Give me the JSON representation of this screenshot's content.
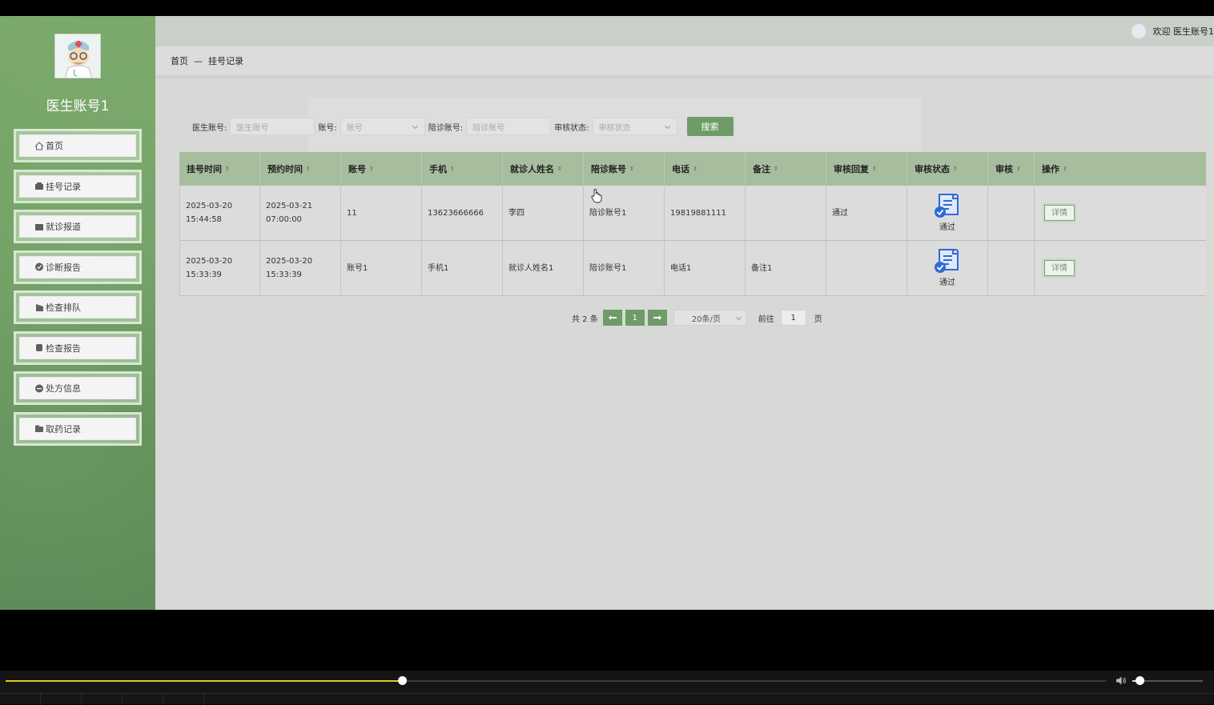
{
  "sidebar": {
    "user_name": "医生账号1",
    "menu": [
      {
        "label": "首页",
        "icon": "home-icon"
      },
      {
        "label": "挂号记录",
        "icon": "register-icon"
      },
      {
        "label": "就诊报道",
        "icon": "checkin-icon"
      },
      {
        "label": "诊断报告",
        "icon": "diagnosis-icon"
      },
      {
        "label": "检查排队",
        "icon": "queue-icon"
      },
      {
        "label": "检查报告",
        "icon": "report-icon"
      },
      {
        "label": "处方信息",
        "icon": "prescription-icon"
      },
      {
        "label": "取药记录",
        "icon": "medicine-icon"
      }
    ]
  },
  "header": {
    "welcome": "欢迎 医生账号1"
  },
  "breadcrumb": {
    "home": "首页",
    "separator": "—",
    "current": "挂号记录"
  },
  "search": {
    "doctor_label": "医生账号:",
    "doctor_placeholder": "医生账号",
    "account_label": "账号:",
    "account_placeholder": "账号",
    "companion_label": "陪诊账号:",
    "companion_placeholder": "陪诊账号",
    "status_label": "审核状态:",
    "status_placeholder": "审核状态",
    "button": "搜索"
  },
  "table": {
    "columns": [
      "挂号时间",
      "预约时间",
      "账号",
      "手机",
      "就诊人姓名",
      "陪诊账号",
      "电话",
      "备注",
      "审核回复",
      "审核状态",
      "审核",
      "操作"
    ],
    "rows": [
      {
        "reg_time": "2025-03-20 15:44:58",
        "appt_time": "2025-03-21 07:00:00",
        "account": "11",
        "phone": "13623666666",
        "patient": "李四",
        "companion": "陪诊账号1",
        "tel": "19819881111",
        "remark": "",
        "reply": "通过",
        "status": "通过",
        "action": "详情"
      },
      {
        "reg_time": "2025-03-20 15:33:39",
        "appt_time": "2025-03-20 15:33:39",
        "account": "账号1",
        "phone": "手机1",
        "patient": "就诊人姓名1",
        "companion": "陪诊账号1",
        "tel": "电话1",
        "remark": "备注1",
        "reply": "",
        "status": "通过",
        "action": "详情"
      }
    ]
  },
  "pagination": {
    "total": "共 2 条",
    "current_page": "1",
    "page_size": "20条/页",
    "goto_label": "前往",
    "goto_value": "1",
    "page_unit": "页"
  },
  "video": {
    "progress": 0.36,
    "volume": 0.1
  },
  "colors": {
    "accent": "#6e9b67",
    "sidebar": "#6e9f60",
    "table_header": "#a6be9e",
    "progress": "#e8c520"
  }
}
